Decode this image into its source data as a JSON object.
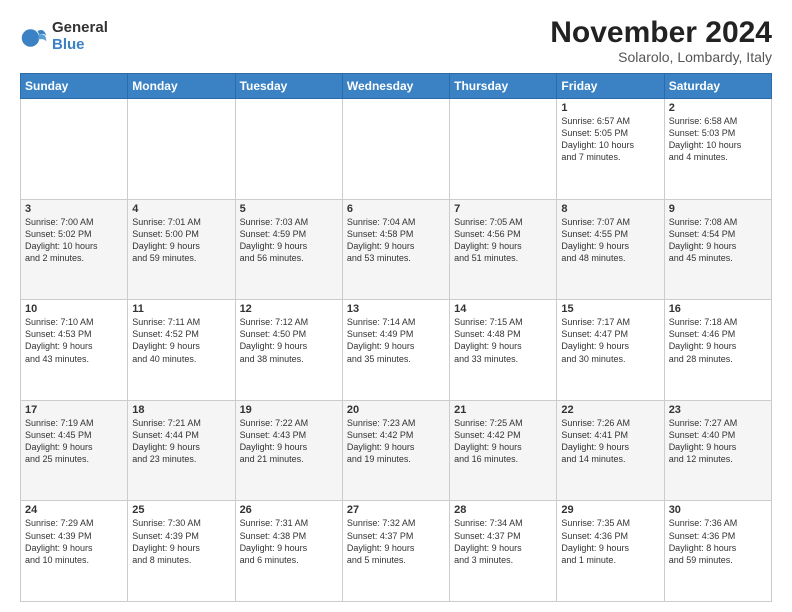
{
  "logo": {
    "general": "General",
    "blue": "Blue"
  },
  "title": "November 2024",
  "location": "Solarolo, Lombardy, Italy",
  "headers": [
    "Sunday",
    "Monday",
    "Tuesday",
    "Wednesday",
    "Thursday",
    "Friday",
    "Saturday"
  ],
  "rows": [
    [
      {
        "day": "",
        "info": ""
      },
      {
        "day": "",
        "info": ""
      },
      {
        "day": "",
        "info": ""
      },
      {
        "day": "",
        "info": ""
      },
      {
        "day": "",
        "info": ""
      },
      {
        "day": "1",
        "info": "Sunrise: 6:57 AM\nSunset: 5:05 PM\nDaylight: 10 hours\nand 7 minutes."
      },
      {
        "day": "2",
        "info": "Sunrise: 6:58 AM\nSunset: 5:03 PM\nDaylight: 10 hours\nand 4 minutes."
      }
    ],
    [
      {
        "day": "3",
        "info": "Sunrise: 7:00 AM\nSunset: 5:02 PM\nDaylight: 10 hours\nand 2 minutes."
      },
      {
        "day": "4",
        "info": "Sunrise: 7:01 AM\nSunset: 5:00 PM\nDaylight: 9 hours\nand 59 minutes."
      },
      {
        "day": "5",
        "info": "Sunrise: 7:03 AM\nSunset: 4:59 PM\nDaylight: 9 hours\nand 56 minutes."
      },
      {
        "day": "6",
        "info": "Sunrise: 7:04 AM\nSunset: 4:58 PM\nDaylight: 9 hours\nand 53 minutes."
      },
      {
        "day": "7",
        "info": "Sunrise: 7:05 AM\nSunset: 4:56 PM\nDaylight: 9 hours\nand 51 minutes."
      },
      {
        "day": "8",
        "info": "Sunrise: 7:07 AM\nSunset: 4:55 PM\nDaylight: 9 hours\nand 48 minutes."
      },
      {
        "day": "9",
        "info": "Sunrise: 7:08 AM\nSunset: 4:54 PM\nDaylight: 9 hours\nand 45 minutes."
      }
    ],
    [
      {
        "day": "10",
        "info": "Sunrise: 7:10 AM\nSunset: 4:53 PM\nDaylight: 9 hours\nand 43 minutes."
      },
      {
        "day": "11",
        "info": "Sunrise: 7:11 AM\nSunset: 4:52 PM\nDaylight: 9 hours\nand 40 minutes."
      },
      {
        "day": "12",
        "info": "Sunrise: 7:12 AM\nSunset: 4:50 PM\nDaylight: 9 hours\nand 38 minutes."
      },
      {
        "day": "13",
        "info": "Sunrise: 7:14 AM\nSunset: 4:49 PM\nDaylight: 9 hours\nand 35 minutes."
      },
      {
        "day": "14",
        "info": "Sunrise: 7:15 AM\nSunset: 4:48 PM\nDaylight: 9 hours\nand 33 minutes."
      },
      {
        "day": "15",
        "info": "Sunrise: 7:17 AM\nSunset: 4:47 PM\nDaylight: 9 hours\nand 30 minutes."
      },
      {
        "day": "16",
        "info": "Sunrise: 7:18 AM\nSunset: 4:46 PM\nDaylight: 9 hours\nand 28 minutes."
      }
    ],
    [
      {
        "day": "17",
        "info": "Sunrise: 7:19 AM\nSunset: 4:45 PM\nDaylight: 9 hours\nand 25 minutes."
      },
      {
        "day": "18",
        "info": "Sunrise: 7:21 AM\nSunset: 4:44 PM\nDaylight: 9 hours\nand 23 minutes."
      },
      {
        "day": "19",
        "info": "Sunrise: 7:22 AM\nSunset: 4:43 PM\nDaylight: 9 hours\nand 21 minutes."
      },
      {
        "day": "20",
        "info": "Sunrise: 7:23 AM\nSunset: 4:42 PM\nDaylight: 9 hours\nand 19 minutes."
      },
      {
        "day": "21",
        "info": "Sunrise: 7:25 AM\nSunset: 4:42 PM\nDaylight: 9 hours\nand 16 minutes."
      },
      {
        "day": "22",
        "info": "Sunrise: 7:26 AM\nSunset: 4:41 PM\nDaylight: 9 hours\nand 14 minutes."
      },
      {
        "day": "23",
        "info": "Sunrise: 7:27 AM\nSunset: 4:40 PM\nDaylight: 9 hours\nand 12 minutes."
      }
    ],
    [
      {
        "day": "24",
        "info": "Sunrise: 7:29 AM\nSunset: 4:39 PM\nDaylight: 9 hours\nand 10 minutes."
      },
      {
        "day": "25",
        "info": "Sunrise: 7:30 AM\nSunset: 4:39 PM\nDaylight: 9 hours\nand 8 minutes."
      },
      {
        "day": "26",
        "info": "Sunrise: 7:31 AM\nSunset: 4:38 PM\nDaylight: 9 hours\nand 6 minutes."
      },
      {
        "day": "27",
        "info": "Sunrise: 7:32 AM\nSunset: 4:37 PM\nDaylight: 9 hours\nand 5 minutes."
      },
      {
        "day": "28",
        "info": "Sunrise: 7:34 AM\nSunset: 4:37 PM\nDaylight: 9 hours\nand 3 minutes."
      },
      {
        "day": "29",
        "info": "Sunrise: 7:35 AM\nSunset: 4:36 PM\nDaylight: 9 hours\nand 1 minute."
      },
      {
        "day": "30",
        "info": "Sunrise: 7:36 AM\nSunset: 4:36 PM\nDaylight: 8 hours\nand 59 minutes."
      }
    ]
  ]
}
